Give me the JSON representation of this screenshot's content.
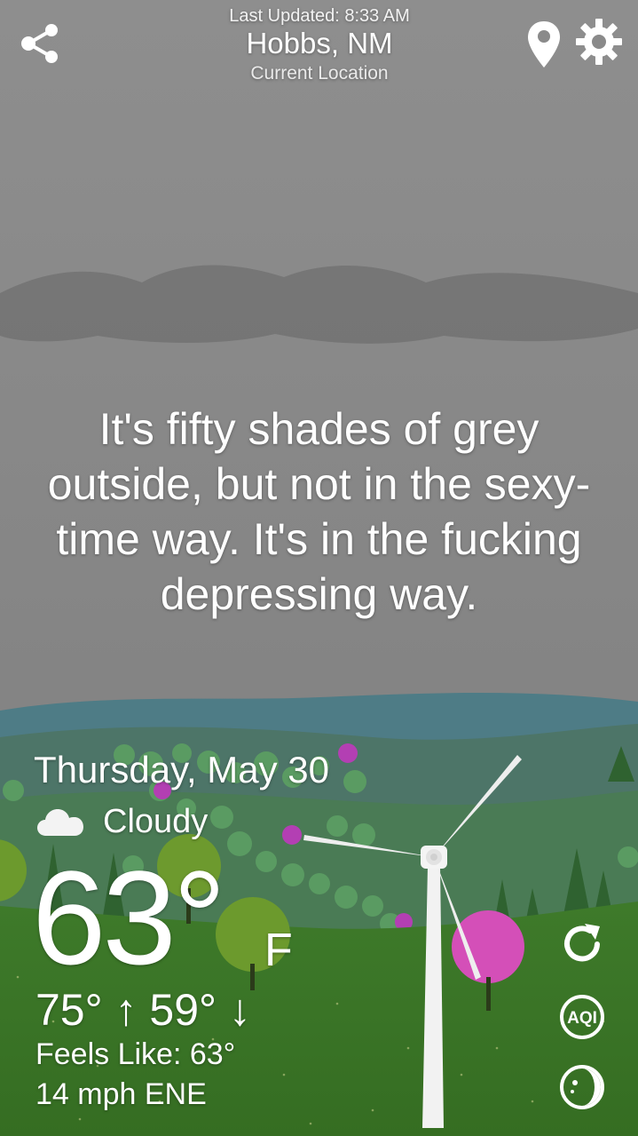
{
  "header": {
    "last_updated": "Last Updated: 8:33 AM",
    "city": "Hobbs, NM",
    "location_label": "Current Location"
  },
  "quote": "It's fifty shades of grey outside, but not in the sexy-time way. It's in the fucking depressing way.",
  "weather": {
    "date": "Thursday, May 30",
    "condition": "Cloudy",
    "condition_icon": "cloud-icon",
    "temperature": "63°",
    "unit": "F",
    "high_low": "75° ↑  59° ↓",
    "feels_like": "Feels Like: 63°",
    "wind": "14 mph ENE"
  },
  "actions": {
    "share_icon": "share-icon",
    "location_icon": "map-pin-icon",
    "settings_icon": "gear-icon",
    "refresh_icon": "refresh-icon",
    "aqi_label": "AQI",
    "moon_icon": "moon-phase-icon"
  },
  "colors": {
    "sky": "#8a8a8a",
    "grass": "#3f7d2b",
    "hills": "#4d7a76",
    "tree_pink": "#d24fb8"
  }
}
